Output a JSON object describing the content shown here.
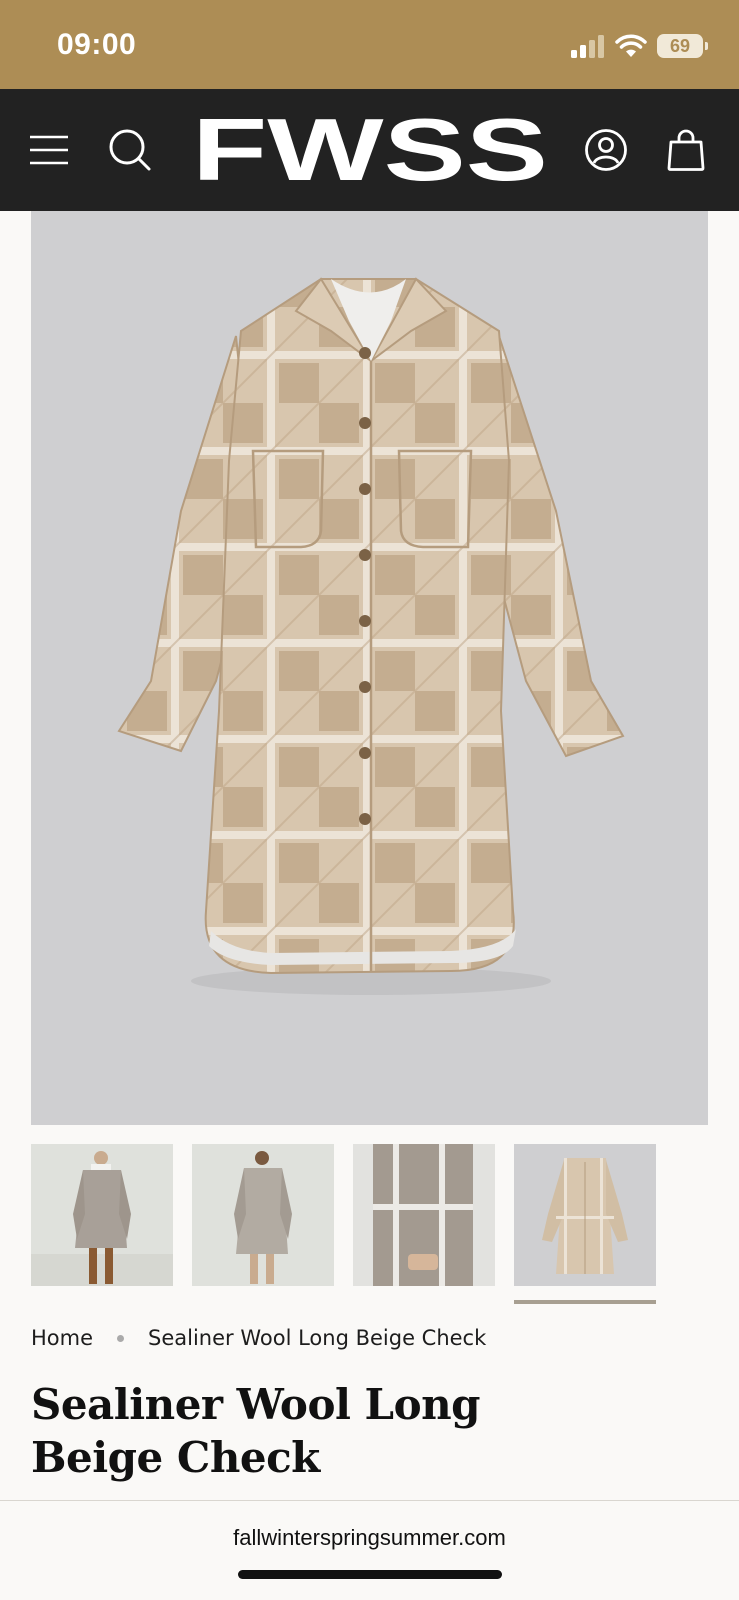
{
  "status_bar": {
    "time": "09:00",
    "battery": "69",
    "background_color": "#ad8d55"
  },
  "header": {
    "logo_text": "FWSS",
    "menu_icon": "menu-icon",
    "search_icon": "search-icon",
    "account_icon": "account-icon",
    "cart_icon": "bag-icon",
    "background_color": "#222222"
  },
  "gallery": {
    "main_image_alt": "Sealiner Wool Long Beige Check",
    "thumbnails": [
      {
        "label": "front-model"
      },
      {
        "label": "back-model"
      },
      {
        "label": "detail-closeup"
      },
      {
        "label": "flat-lay"
      }
    ],
    "active_thumbnail_index": 3
  },
  "breadcrumb": {
    "home": "Home",
    "current": "Sealiner Wool Long Beige Check"
  },
  "product": {
    "title": "Sealiner Wool Long Beige Check"
  },
  "browser": {
    "url": "fallwinterspringsummer.com"
  }
}
